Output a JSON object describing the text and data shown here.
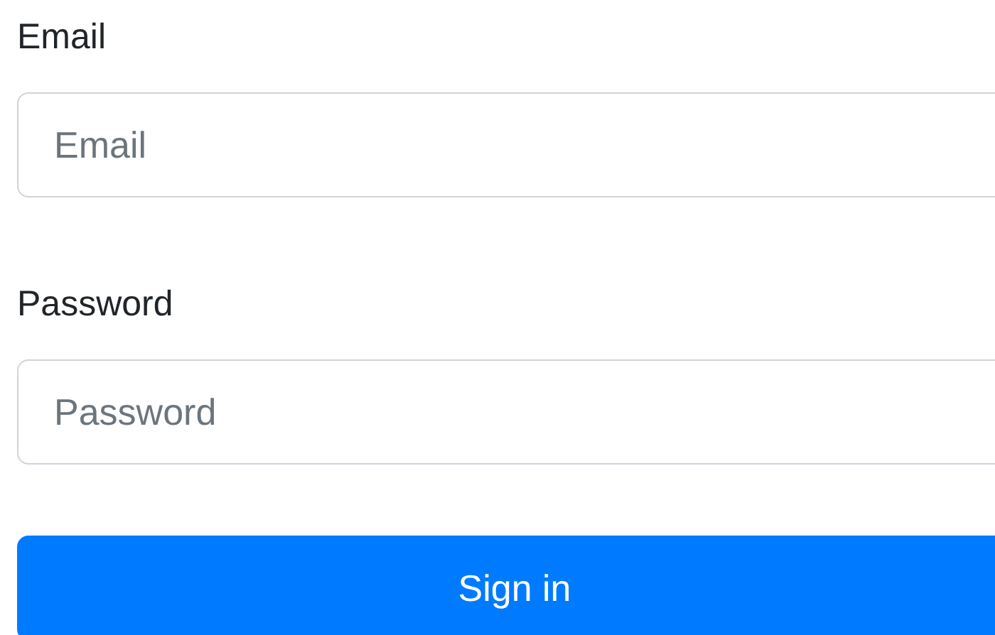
{
  "fields": [
    {
      "label": "Email",
      "placeholder": "Email"
    },
    {
      "label": "Password",
      "placeholder": "Password"
    }
  ],
  "submit_button": "Sign in"
}
